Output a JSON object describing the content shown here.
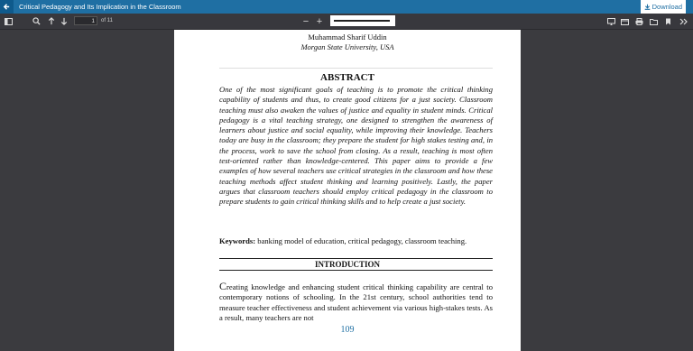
{
  "header": {
    "back_icon": "arrow-left-icon",
    "title": "Critical Pedagogy and Its Implication in the Classroom",
    "download_label": "Download",
    "download_icon": "download-icon"
  },
  "toolbar": {
    "page_input": "1",
    "page_total": "of 11",
    "zoom_out": "−",
    "zoom_in": "+"
  },
  "page": {
    "author": "Muhammad Sharif Uddin",
    "affiliation": "Morgan State University, USA",
    "abstract_heading": "ABSTRACT",
    "abstract_text": "One of the most significant goals of teaching is to promote the critical thinking capability of students and thus, to create good citizens for a just society. Classroom teaching must also awaken the values of justice and equality in student minds. Critical pedagogy is a vital teaching strategy, one designed to strengthen the awareness of learners about justice and social equality, while improving their knowledge. Teachers today are busy in the classroom; they prepare the student for high stakes testing and, in the process, work to save the school from closing. As a result, teaching is most often test-oriented rather than knowledge-centered. This paper aims to provide a few examples of how several teachers use critical strategies in the classroom and how these teaching methods affect student thinking and learning positively. Lastly, the paper argues that classroom teachers should employ critical pedagogy in the classroom to prepare students to gain critical thinking skills and to help create a just society.",
    "keywords_label": "Keywords:",
    "keywords_text": "banking model of education, critical pedagogy, classroom teaching.",
    "intro_heading": "INTRODUCTION",
    "intro_first_letter": "C",
    "intro_text": "reating knowledge and enhancing student critical thinking capability are central to contemporary notions of schooling. In the 21st century, school authorities tend to measure teacher effectiveness and student achievement via various high-stakes tests. As a result, many teachers are not",
    "page_number": "109"
  }
}
